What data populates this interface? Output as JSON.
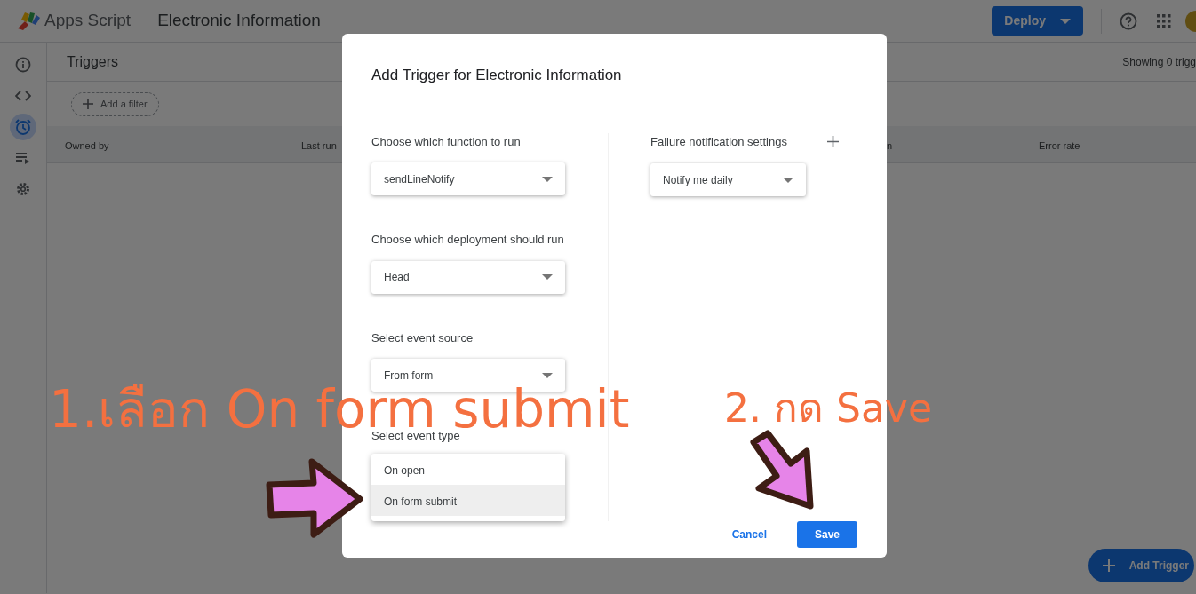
{
  "app_bar": {
    "product": "Apps Script",
    "project": "Electronic Information",
    "deploy_button": "Deploy"
  },
  "sidebar": {
    "items": [
      {
        "kind": "info",
        "selected": false
      },
      {
        "kind": "code",
        "selected": false
      },
      {
        "kind": "clock",
        "selected": true
      },
      {
        "kind": "list",
        "selected": false
      },
      {
        "kind": "gear",
        "selected": false
      }
    ]
  },
  "triggers": {
    "title": "Triggers",
    "count_text": "Showing 0 trigg",
    "filter": "Add a filter",
    "columns": [
      "Owned by",
      "Last run",
      "n",
      "Error rate"
    ],
    "add_trigger": "Add Trigger"
  },
  "dialog": {
    "title": "Add Trigger for Electronic Information",
    "fields": [
      {
        "label": "Choose which function to run",
        "value": "sendLineNotify"
      },
      {
        "label": "Choose which deployment should run",
        "value": "Head"
      },
      {
        "label": "Select event source",
        "value": "From form"
      }
    ],
    "event_type": {
      "label": "Select event type",
      "options": [
        {
          "label": "On open",
          "selected": false
        },
        {
          "label": "On form submit",
          "selected": true
        }
      ]
    },
    "failure": {
      "label": "Failure notification settings",
      "value": "Notify me daily"
    },
    "cancel": "Cancel",
    "save": "Save"
  },
  "annotations": [
    {
      "text": "1.เลือก On form submit"
    },
    {
      "text": "2. กด Save"
    }
  ]
}
